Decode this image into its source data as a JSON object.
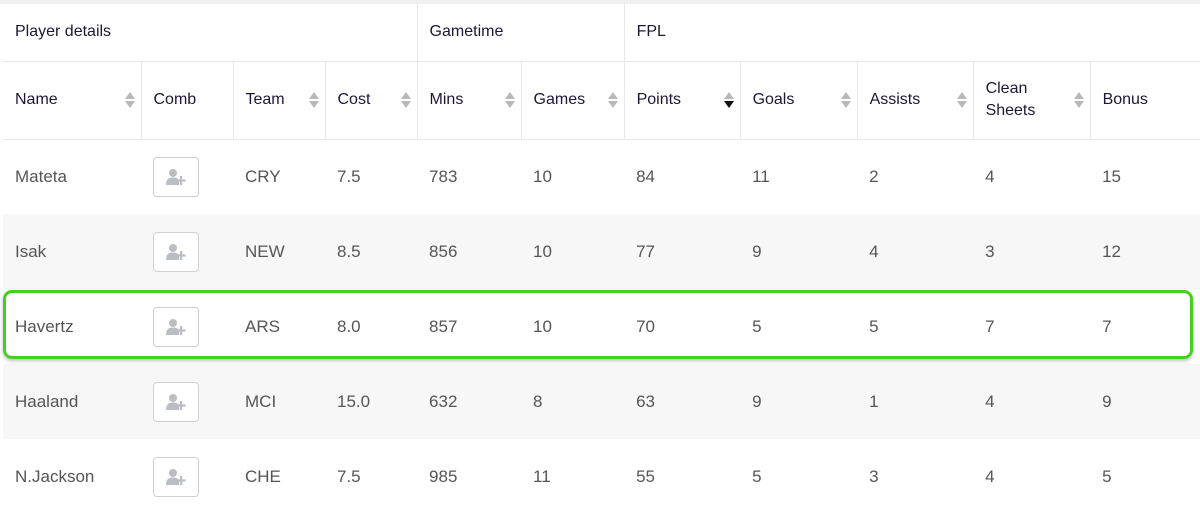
{
  "table": {
    "groups": [
      {
        "label": "Player details",
        "span": 4
      },
      {
        "label": "Gametime",
        "span": 2
      },
      {
        "label": "FPL",
        "span": 5
      }
    ],
    "columns": [
      {
        "key": "name",
        "label": "Name",
        "sortable": true,
        "sort": "none"
      },
      {
        "key": "comb",
        "label": "Comb",
        "sortable": false,
        "sort": "none"
      },
      {
        "key": "team",
        "label": "Team",
        "sortable": true,
        "sort": "none"
      },
      {
        "key": "cost",
        "label": "Cost",
        "sortable": true,
        "sort": "none"
      },
      {
        "key": "mins",
        "label": "Mins",
        "sortable": true,
        "sort": "none"
      },
      {
        "key": "games",
        "label": "Games",
        "sortable": true,
        "sort": "none"
      },
      {
        "key": "points",
        "label": "Points",
        "sortable": true,
        "sort": "desc"
      },
      {
        "key": "goals",
        "label": "Goals",
        "sortable": true,
        "sort": "none"
      },
      {
        "key": "assists",
        "label": "Assists",
        "sortable": true,
        "sort": "none"
      },
      {
        "key": "clean_sheets",
        "label": "Clean Sheets",
        "sortable": true,
        "sort": "none"
      },
      {
        "key": "bonus",
        "label": "Bonus",
        "sortable": true,
        "sort": "none"
      }
    ],
    "rows": [
      {
        "name": "Mateta",
        "team": "CRY",
        "cost": "7.5",
        "mins": "783",
        "games": "10",
        "points": "84",
        "goals": "11",
        "assists": "2",
        "clean_sheets": "4",
        "bonus": "15"
      },
      {
        "name": "Isak",
        "team": "NEW",
        "cost": "8.5",
        "mins": "856",
        "games": "10",
        "points": "77",
        "goals": "9",
        "assists": "4",
        "clean_sheets": "3",
        "bonus": "12"
      },
      {
        "name": "Havertz",
        "team": "ARS",
        "cost": "8.0",
        "mins": "857",
        "games": "10",
        "points": "70",
        "goals": "5",
        "assists": "5",
        "clean_sheets": "7",
        "bonus": "7",
        "highlighted": true
      },
      {
        "name": "Haaland",
        "team": "MCI",
        "cost": "15.0",
        "mins": "632",
        "games": "8",
        "points": "63",
        "goals": "9",
        "assists": "1",
        "clean_sheets": "4",
        "bonus": "9"
      },
      {
        "name": "N.Jackson",
        "team": "CHE",
        "cost": "7.5",
        "mins": "985",
        "games": "11",
        "points": "55",
        "goals": "5",
        "assists": "3",
        "clean_sheets": "4",
        "bonus": "5"
      }
    ],
    "comb_icon": "add-user-icon"
  },
  "colors": {
    "highlight": "#43d01e",
    "header_text": "#1e1636",
    "cell_text": "#555555",
    "sort_active": "#111111",
    "sort_inactive": "#b8b8b8"
  }
}
